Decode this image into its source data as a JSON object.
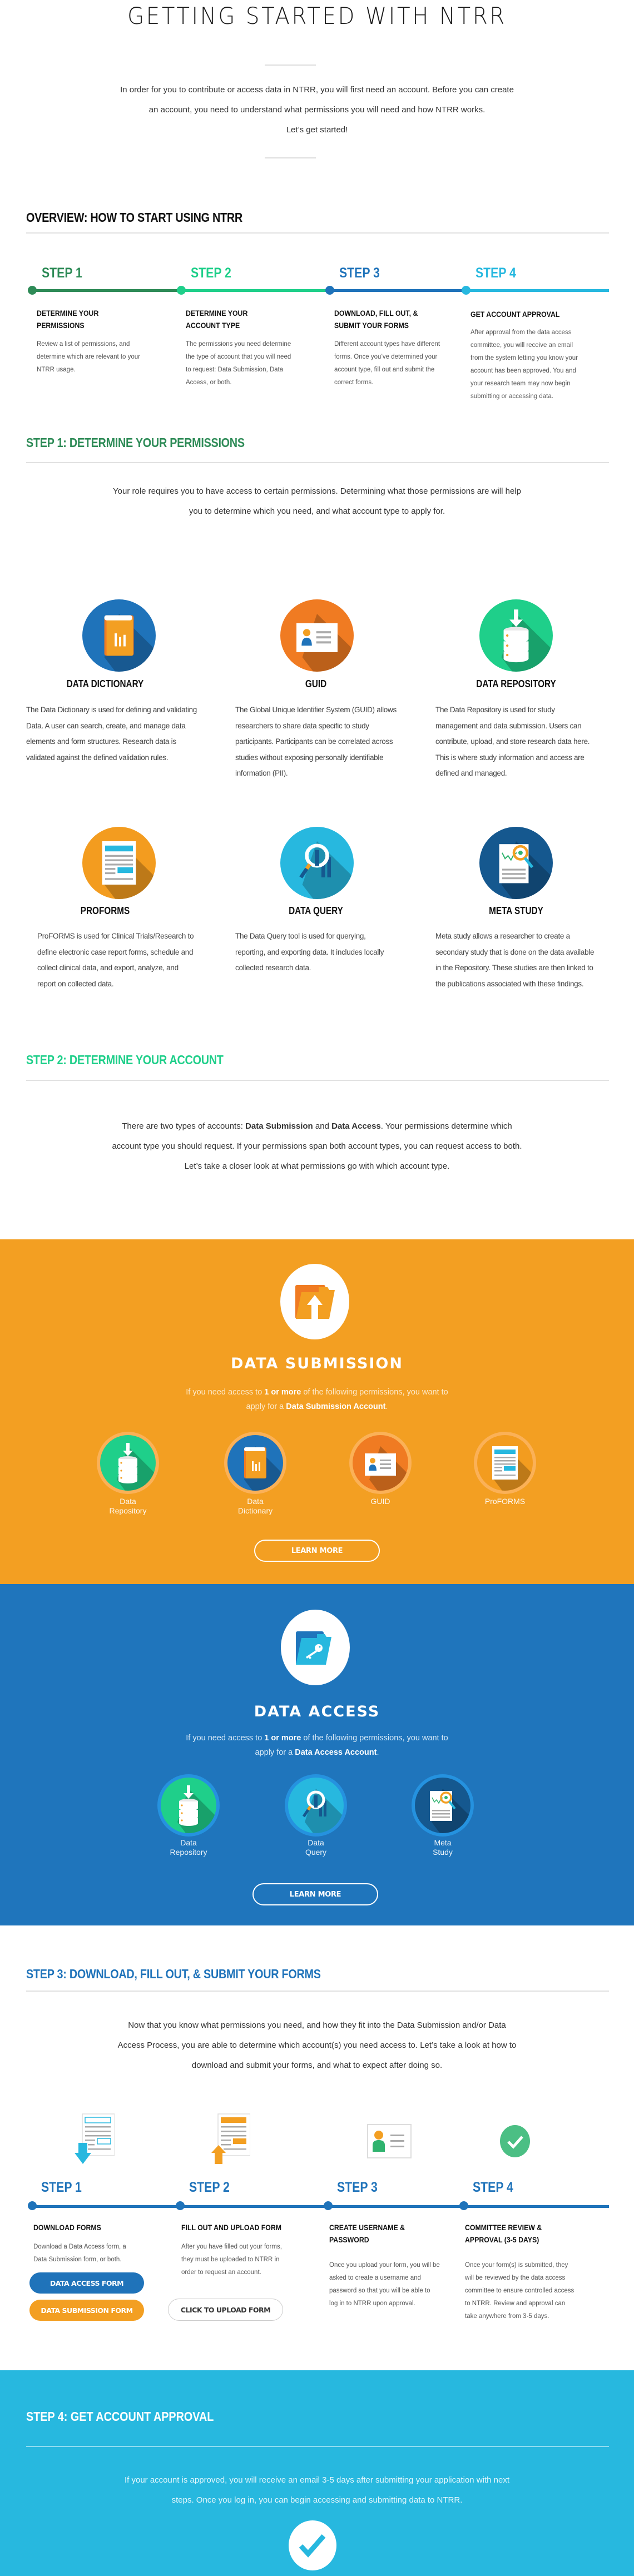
{
  "header": {
    "title": "GETTING STARTED WITH NTRR",
    "intro_line1": "In order for you to contribute or access data in NTRR, you will first need an account. Before you can create",
    "intro_line2": "an account, you need to understand what permissions you will need and how NTRR works.",
    "intro_line3": "Let’s get started!"
  },
  "overview": {
    "title": "OVERVIEW: HOW TO START USING NTRR",
    "steps": [
      {
        "label": "STEP 1",
        "heading": "DETERMINE YOUR PERMISSIONS",
        "desc": "Review a list of permissions, and determine which are relevant to your NTRR usage.",
        "color": "#2e8b57"
      },
      {
        "label": "STEP 2",
        "heading": "DETERMINE YOUR ACCOUNT TYPE",
        "desc": "The permissions you need determine the type of account that you will need to request: Data Submission, Data Access, or both.",
        "color": "#1fcf8a"
      },
      {
        "label": "STEP 3",
        "heading": "DOWNLOAD, FILL OUT, & SUBMIT YOUR FORMS",
        "desc": "Different account types have different forms. Once you’ve determined your account type, fill out and submit the correct forms.",
        "color": "#1f73ba"
      },
      {
        "label": "STEP 4",
        "heading": "GET ACCOUNT APPROVAL",
        "desc": "After approval from the data access committee, you will receive an email from the system letting you know your account has been approved. You and your research team may now begin submitting or accessing data.",
        "color": "#27b8df"
      }
    ]
  },
  "step1": {
    "title": "STEP 1: DETERMINE YOUR PERMISSIONS",
    "title_color": "#2e8b57",
    "intro_line1": "Your role requires you to have access to certain permissions. Determining what those permissions are will help",
    "intro_line2": "you to determine which you need, and what account type to apply for.",
    "permissions": [
      {
        "icon": "book-chart-icon",
        "title": "DATA DICTIONARY",
        "desc": "The Data Dictionary is used for defining and validating Data. A user can search, create, and manage data elements and form structures. Research data is validated against the defined validation rules.",
        "color": "#1f73ba"
      },
      {
        "icon": "id-card-icon",
        "title": "GUID",
        "desc": "The Global Unique Identifier System (GUID) allows researchers to share data specific to study participants. Participants can be correlated across studies without exposing personally identifiable information (PII).",
        "color": "#f07b22"
      },
      {
        "icon": "database-download-icon",
        "title": "DATA REPOSITORY",
        "desc": "The Data Repository is used for study management and data submission. Users can contribute, upload, and store research data here.  This is where study information and access are defined and managed.",
        "color": "#1fcf8a"
      },
      {
        "icon": "form-document-icon",
        "title": "PROFORMS",
        "desc": "ProFORMS is used for Clinical Trials/Research to define electronic case report forms, schedule and collect clinical data, and export, analyze, and report on collected data.",
        "color": "#f39c1f"
      },
      {
        "icon": "magnifier-chart-icon",
        "title": "DATA QUERY",
        "desc": "The Data Query tool is used for querying, reporting, and exporting data. It includes locally collected research data.",
        "color": "#27b8df"
      },
      {
        "icon": "document-magnifier-icon",
        "title": "META STUDY",
        "desc": "Meta study allows a researcher to create a secondary study that is done on the data available in the Repository. These studies are then linked to the publications associated with these findings.",
        "color": "#15588f"
      }
    ]
  },
  "step2": {
    "title": "STEP 2: DETERMINE YOUR ACCOUNT",
    "title_color": "#1fcf8a",
    "intro_pre": "There are two types of accounts: ",
    "intro_bold1": "Data Submission",
    "intro_mid": " and ",
    "intro_bold2": "Data Access",
    "intro_post": ". Your permissions determine which",
    "intro_line2": "account type you should request. If your permissions span both account types, you can request access to both.",
    "intro_line3": "Let’s take a closer look at what permissions go with which account type."
  },
  "submission": {
    "bg": "#f39f22",
    "title": "DATA SUBMISSION",
    "desc_pre": "If you need access to ",
    "desc_bold1": "1 or more",
    "desc_mid": " of the following permissions, you want to",
    "desc_line2_pre": "apply for a ",
    "desc_bold2": "Data Submission Account",
    "desc_end": ".",
    "items": [
      {
        "label_line1": "Data",
        "label_line2": "Repository",
        "icon": "database-download-icon"
      },
      {
        "label_line1": "Data",
        "label_line2": "Dictionary",
        "icon": "book-chart-icon"
      },
      {
        "label_line1": "GUID",
        "label_line2": "",
        "icon": "id-card-icon"
      },
      {
        "label_line1": "ProFORMS",
        "label_line2": "",
        "icon": "form-document-icon"
      }
    ],
    "button": "LEARN MORE"
  },
  "access": {
    "bg": "#1f75bc",
    "title": "DATA ACCESS",
    "desc_pre": "If you need access to ",
    "desc_bold1": "1 or more",
    "desc_mid": " of the following permissions, you want to",
    "desc_line2_pre": "apply for a ",
    "desc_bold2": "Data Access Account",
    "desc_end": ".",
    "items": [
      {
        "label_line1": "Data",
        "label_line2": "Repository",
        "icon": "database-download-icon"
      },
      {
        "label_line1": "Data",
        "label_line2": "Query",
        "icon": "magnifier-chart-icon"
      },
      {
        "label_line1": "Meta",
        "label_line2": "Study",
        "icon": "document-magnifier-icon"
      }
    ],
    "button": "LEARN MORE"
  },
  "step3": {
    "title": "STEP 3: DOWNLOAD, FILL OUT, & SUBMIT YOUR FORMS",
    "title_color": "#1f73ba",
    "intro_line1": "Now that you know what permissions you need, and how they fit into the Data Submission and/or Data",
    "intro_line2": "Access Process, you are able to determine which account(s) you need access to. Let’s take a look at how to",
    "intro_line3": "download and submit your forms, and what to expect after doing so.",
    "steps": [
      {
        "label": "STEP 1",
        "heading": "DOWNLOAD FORMS",
        "desc": "Download a Data Access form,  a Data Submission form, or both.",
        "icon": "form-download-icon"
      },
      {
        "label": "STEP 2",
        "heading": "FILL OUT AND UPLOAD FORM",
        "desc": "After you have filled out your forms, they must be uploaded to NTRR in order to request an account.",
        "icon": "form-upload-icon"
      },
      {
        "label": "STEP 3",
        "heading": "CREATE USERNAME & PASSWORD",
        "desc": "Once you upload your form, you will be asked to create a username and password so that you will be able to log in to NTRR upon approval.",
        "icon": "user-card-icon"
      },
      {
        "label": "STEP 4",
        "heading": "COMMITTEE REVIEW & APPROVAL (3-5 DAYS)",
        "desc": "Once your form(s) is submitted, they will be reviewed by the data access committee to ensure controlled access to NTRR. Review and approval can take anywhere from 3-5 days.",
        "icon": "check-circle-icon"
      }
    ],
    "btn_access_form": "DATA ACCESS FORM",
    "btn_submission_form": "DATA SUBMISSION FORM",
    "btn_upload": "CLICK TO UPLOAD FORM",
    "color_blue": "#1f73ba",
    "color_orange": "#f39f22"
  },
  "step4": {
    "title": "STEP 4: GET ACCOUNT APPROVAL",
    "desc_line1": "If your account is approved, you will receive an email 3-5 days after submitting your application with next",
    "desc_line2": "steps. Once you log in, you can begin accessing and submitting data to NTRR."
  }
}
